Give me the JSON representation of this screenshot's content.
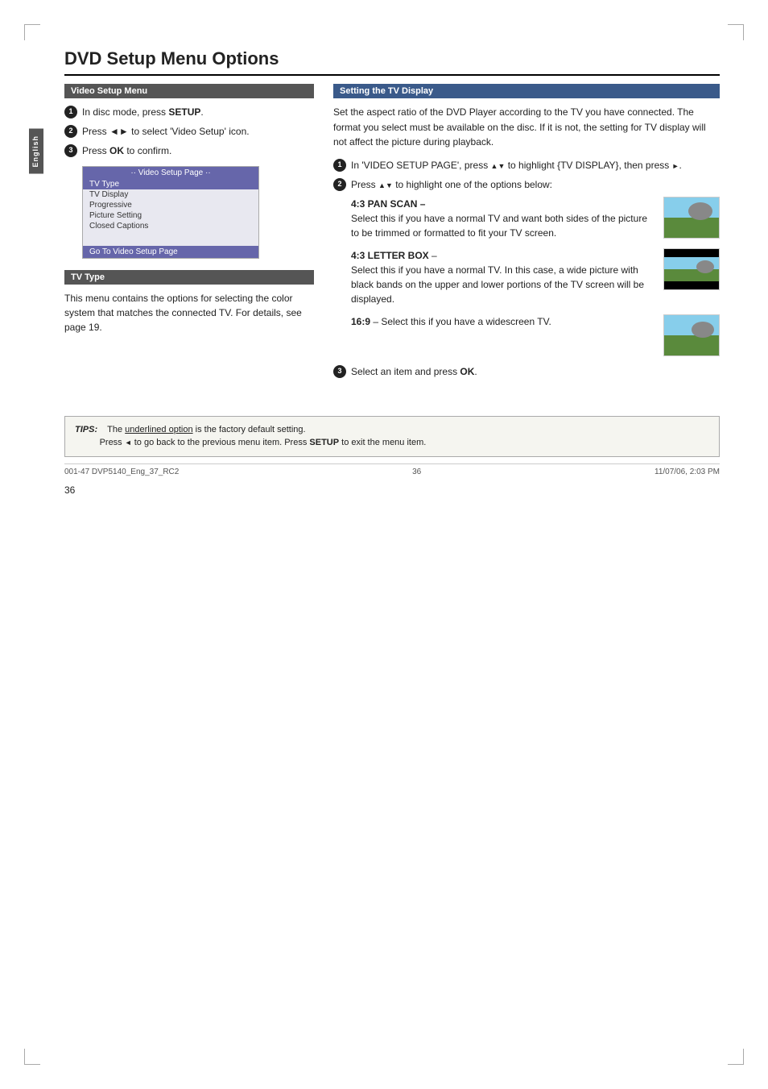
{
  "page": {
    "title": "DVD Setup Menu Options",
    "sidebar_label": "English",
    "page_number": "36"
  },
  "left_column": {
    "video_setup_menu": {
      "header": "Video Setup Menu",
      "steps": [
        {
          "num": "1",
          "text": "In disc mode, press ",
          "bold": "SETUP",
          "after": "."
        },
        {
          "num": "2",
          "text": "Press ",
          "bold_left": "◄►",
          "mid": " to select 'Video Setup' icon.",
          "bold": ""
        },
        {
          "num": "3",
          "text": "Press ",
          "bold": "OK",
          "after": " to confirm."
        }
      ],
      "menu_screenshot": {
        "title": "·· Video Setup Page ··",
        "items": [
          "TV Type",
          "TV Display",
          "Progressive",
          "Picture Setting",
          "Closed Captions"
        ],
        "footer": "Go To Video Setup Page"
      }
    },
    "tv_type": {
      "header": "TV Type",
      "text": "This menu contains the options for selecting the color system that matches the connected TV.  For details, see page 19."
    }
  },
  "right_column": {
    "setting_tv_display": {
      "header": "Setting the TV Display",
      "intro": "Set the aspect ratio of the DVD Player according to the TV you have connected. The format you select must be available on the disc.  If it is not, the setting for TV display will not affect the picture during playback.",
      "steps": [
        {
          "num": "1",
          "text": "In 'VIDEO SETUP PAGE', press ▲ ▼ to highlight {TV DISPLAY}, then press ►."
        },
        {
          "num": "2",
          "text": "Press ▲ ▼ to highlight one of the options below:"
        }
      ],
      "options": [
        {
          "id": "pan_scan",
          "title": "4:3 PAN SCAN –",
          "text": "Select this if you have a normal TV and want both sides of the picture to be trimmed or formatted to fit your TV screen.",
          "thumb_type": "pan_scan"
        },
        {
          "id": "letter_box",
          "title": "4:3 LETTER BOX",
          "separator": " –",
          "text": "Select this if you have a normal TV. In this case, a wide picture with black bands on the upper and lower portions of the TV screen will be displayed.",
          "thumb_type": "letterbox"
        },
        {
          "id": "widescreen",
          "title": "16:9",
          "text": " – Select this if you have a widescreen TV.",
          "thumb_type": "widescreen"
        }
      ],
      "step3": {
        "num": "3",
        "text": "Select an item and press ",
        "bold": "OK",
        "after": "."
      }
    }
  },
  "tips": {
    "label": "TIPS:",
    "line1": "The underlined option is the factory default setting.",
    "line2": "Press ◄ to go back to the previous menu item. Press SETUP to exit the menu item."
  },
  "footer": {
    "left": "001-47 DVP5140_Eng_37_RC2",
    "center": "36",
    "right": "11/07/06, 2:03 PM"
  }
}
